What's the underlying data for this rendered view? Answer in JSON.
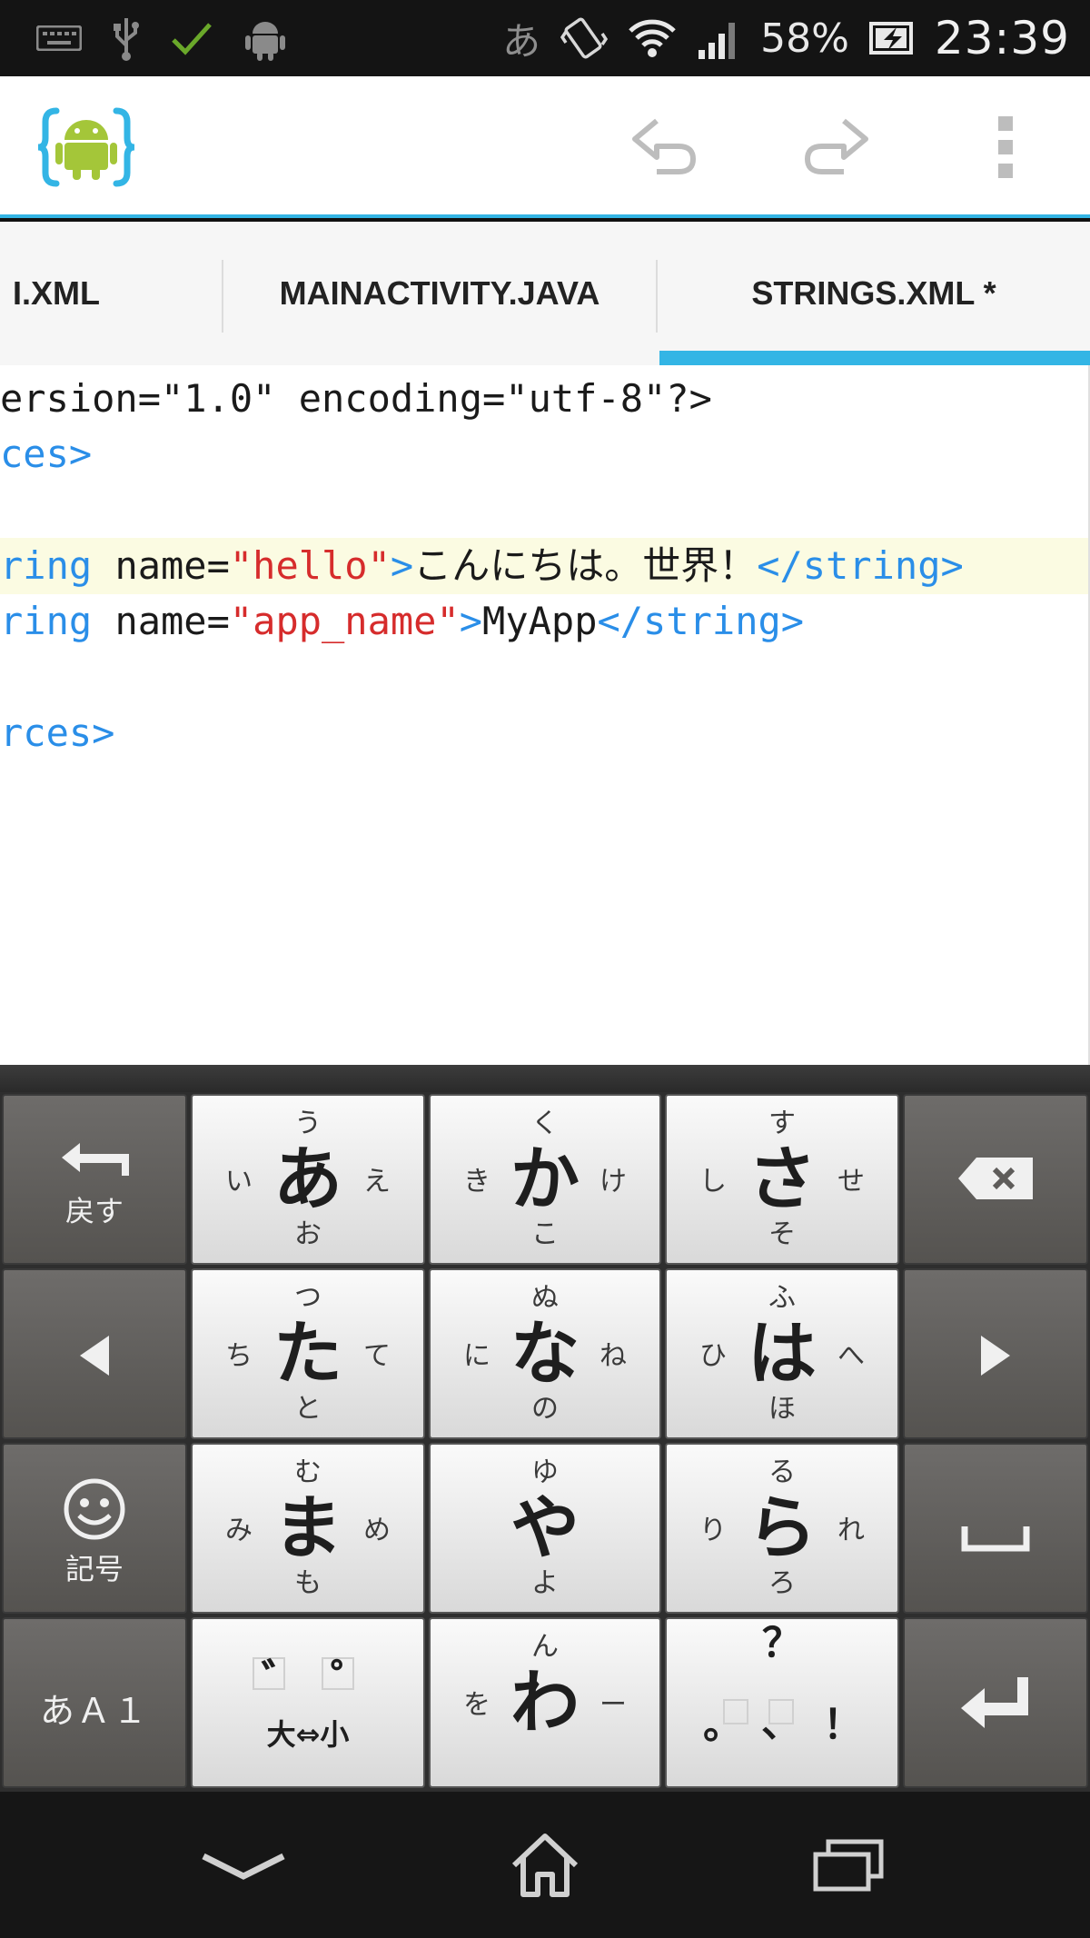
{
  "status_bar": {
    "battery": "58%",
    "time": "23:39",
    "input_mode": "あ",
    "icons": [
      "keyboard-icon",
      "usb-icon",
      "check-icon",
      "android-debug-icon",
      "vibrate-icon",
      "wifi-icon",
      "signal-icon",
      "battery-icon"
    ]
  },
  "action_bar": {
    "icons": [
      "app-logo-icon",
      "undo-icon",
      "redo-icon",
      "overflow-menu-icon"
    ],
    "accent_color": "#33b5e5"
  },
  "tabs": [
    {
      "label": "ACTIVITY_MAIN.XML",
      "visible_label": "I.XML"
    },
    {
      "label": "MAINACTIVITY.JAVA"
    },
    {
      "label": "STRINGS.XML *",
      "active": true
    }
  ],
  "editor": {
    "lines": [
      {
        "plain": "ersion=\"1.0\" encoding=\"utf-8\"?>"
      },
      {
        "tag": "ces>"
      },
      {},
      {
        "tag1": "ring",
        "plain1": " name=",
        "str": "\"hello\"",
        "tag2": ">",
        "plain2": "こんにちは。世界！",
        "tag3": "</string>"
      },
      {
        "tag1": "ring",
        "plain1": " name=",
        "str": "\"app_name\"",
        "tag2": ">",
        "plain2": "MyApp",
        "tag3": "</string>"
      },
      {},
      {
        "tag": "rces>"
      }
    ],
    "colors": {
      "tag": "#2a8ee8",
      "string": "#d62c2c",
      "highlight": "#fbfbe2"
    }
  },
  "keyboard": {
    "back_label": "戻す",
    "symbol_label": "記号",
    "mode_label": "あＡ１",
    "dakuten_label": "大⇔小",
    "keys": {
      "a": {
        "main": "あ",
        "up": "う",
        "left": "い",
        "right": "え",
        "down": "お"
      },
      "ka": {
        "main": "か",
        "up": "く",
        "left": "き",
        "right": "け",
        "down": "こ"
      },
      "sa": {
        "main": "さ",
        "up": "す",
        "left": "し",
        "right": "せ",
        "down": "そ"
      },
      "ta": {
        "main": "た",
        "up": "つ",
        "left": "ち",
        "right": "て",
        "down": "と"
      },
      "na": {
        "main": "な",
        "up": "ぬ",
        "left": "に",
        "right": "ね",
        "down": "の"
      },
      "ha": {
        "main": "は",
        "up": "ふ",
        "left": "ひ",
        "right": "へ",
        "down": "ほ"
      },
      "ma": {
        "main": "ま",
        "up": "む",
        "left": "み",
        "right": "め",
        "down": "も"
      },
      "ya": {
        "main": "や",
        "up": "ゆ",
        "down": "よ"
      },
      "ra": {
        "main": "ら",
        "up": "る",
        "left": "り",
        "right": "れ",
        "down": "ろ"
      },
      "wa": {
        "main": "わ",
        "up": "ん",
        "left": "を",
        "right": "ー"
      },
      "dakuten": {
        "left": "゛",
        "right": "゜"
      },
      "punct": {
        "up": "？",
        "left": "。",
        "center": "、",
        "right": "！"
      }
    }
  },
  "nav_bar": {
    "icons": [
      "back-icon",
      "home-icon",
      "recent-apps-icon"
    ]
  }
}
